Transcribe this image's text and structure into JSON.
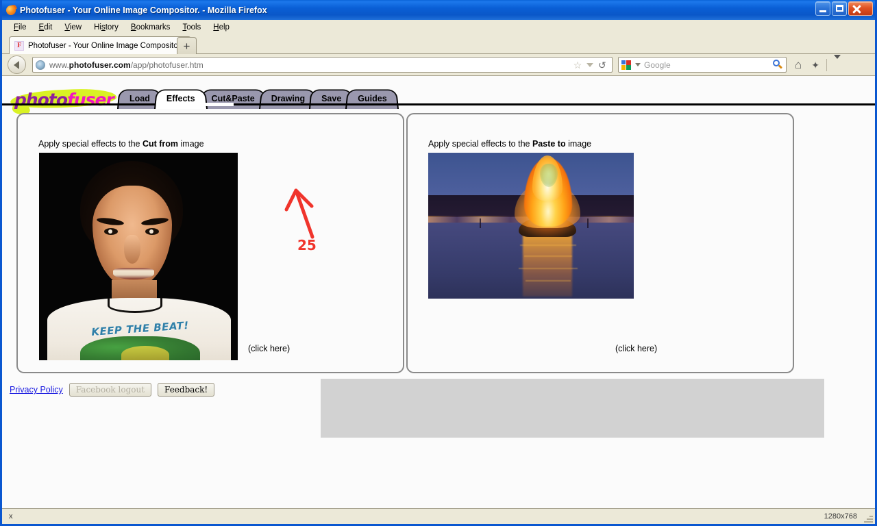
{
  "window": {
    "title": "Photofuser - Your Online Image Compositor. - Mozilla Firefox",
    "minimize_label": "Minimize",
    "maximize_label": "Maximize",
    "close_label": "Close"
  },
  "menubar": {
    "items": [
      {
        "label": "File",
        "accel": "F"
      },
      {
        "label": "Edit",
        "accel": "E"
      },
      {
        "label": "View",
        "accel": "V"
      },
      {
        "label": "History",
        "accel": "s"
      },
      {
        "label": "Bookmarks",
        "accel": "B"
      },
      {
        "label": "Tools",
        "accel": "T"
      },
      {
        "label": "Help",
        "accel": "H"
      }
    ]
  },
  "browser_tabs": {
    "active_tab_title": "Photofuser - Your Online Image Compositor.",
    "favicon_letter": "F",
    "new_tab_label": "+"
  },
  "navbar": {
    "back_label": "Back",
    "url_prefix": "www.",
    "url_domain": "photofuser.com",
    "url_path": "/app/photofuser.htm",
    "bookmark_icon": "☆",
    "reload_icon": "↻",
    "search_placeholder": "Google",
    "home_icon": "⌂",
    "addon_icon": "✦",
    "chevron_icon": "chevron-down"
  },
  "site": {
    "logo_part1": "photo",
    "logo_part2": "fuser",
    "tabs": [
      {
        "label": "Load",
        "active": false
      },
      {
        "label": "Effects",
        "active": true
      },
      {
        "label": "Cut&Paste",
        "active": false
      },
      {
        "label": "Drawing",
        "active": false
      },
      {
        "label": "Save",
        "active": false
      },
      {
        "label": "Guides",
        "active": false
      }
    ],
    "annotation": {
      "number": "25",
      "color": "#f0342b",
      "points_to": "Cut&Paste"
    },
    "panels": {
      "left": {
        "caption_pre": "Apply special effects to the ",
        "caption_bold": "Cut from",
        "caption_post": " image",
        "click_here": "(click here)",
        "image_alt": "Portrait photo of a man on a black background wearing a white t-shirt",
        "shirt_text": "KEEP THE BEAT!"
      },
      "right": {
        "caption_pre": "Apply special effects to the ",
        "caption_bold": "Paste to",
        "caption_post": " image",
        "click_here": "(click here)",
        "image_alt": "Large bonfire burning on water at dusk with reflection"
      }
    },
    "footer": {
      "privacy_policy": "Privacy Policy",
      "facebook_logout": "Facebook logout",
      "feedback": "Feedback!"
    }
  },
  "statusbar": {
    "left_text": "x",
    "right_text": "1280x768"
  },
  "colors": {
    "titlebar_blue": "#0a5fd6",
    "tab_inactive": "#9a98ae",
    "tab_active": "#ffffff",
    "logo_purple": "#8e1f9e",
    "logo_pink": "#f215c0",
    "logo_highlight": "#d9f224",
    "annotation_red": "#f0342b",
    "link_blue": "#1a1ae0",
    "chrome_beige": "#ece9d8",
    "ad_gray": "#d2d2d2"
  }
}
